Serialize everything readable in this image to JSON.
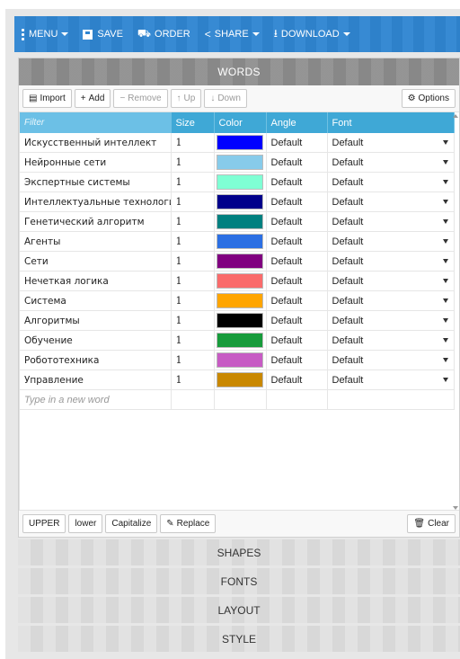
{
  "topbar": {
    "menu_label": "MENU",
    "save_label": "SAVE",
    "order_label": "ORDER",
    "share_label": "SHARE",
    "download_label": "DOWNLOAD"
  },
  "words_section": {
    "title": "WORDS",
    "toolbar": {
      "import": "Import",
      "add": "Add",
      "remove": "Remove",
      "up": "Up",
      "down": "Down",
      "options": "Options"
    },
    "columns": {
      "filter_placeholder": "Filter",
      "size": "Size",
      "color": "Color",
      "angle": "Angle",
      "font": "Font"
    },
    "rows": [
      {
        "word": "Искусственный интеллект",
        "size": "1",
        "color": "#0000ff",
        "angle": "Default",
        "font": "Default"
      },
      {
        "word": "Нейронные сети",
        "size": "1",
        "color": "#87cbea",
        "angle": "Default",
        "font": "Default"
      },
      {
        "word": "Экспертные системы",
        "size": "1",
        "color": "#7fffd4",
        "angle": "Default",
        "font": "Default"
      },
      {
        "word": "Интеллектуальные технологии",
        "size": "1",
        "color": "#00008b",
        "angle": "Default",
        "font": "Default"
      },
      {
        "word": "Генетический алгоритм",
        "size": "1",
        "color": "#008080",
        "angle": "Default",
        "font": "Default"
      },
      {
        "word": "Агенты",
        "size": "1",
        "color": "#2b6fe3",
        "angle": "Default",
        "font": "Default"
      },
      {
        "word": "Сети",
        "size": "1",
        "color": "#800080",
        "angle": "Default",
        "font": "Default"
      },
      {
        "word": "Нечеткая логика",
        "size": "1",
        "color": "#fa6b6b",
        "angle": "Default",
        "font": "Default"
      },
      {
        "word": "Система",
        "size": "1",
        "color": "#ffa500",
        "angle": "Default",
        "font": "Default"
      },
      {
        "word": "Алгоритмы",
        "size": "1",
        "color": "#000000",
        "angle": "Default",
        "font": "Default"
      },
      {
        "word": "Обучение",
        "size": "1",
        "color": "#179b3b",
        "angle": "Default",
        "font": "Default"
      },
      {
        "word": "Робототехника",
        "size": "1",
        "color": "#c75bc4",
        "angle": "Default",
        "font": "Default"
      },
      {
        "word": "Управление",
        "size": "1",
        "color": "#c98800",
        "angle": "Default",
        "font": "Default"
      }
    ],
    "new_word_placeholder": "Type in a new word",
    "bottom_toolbar": {
      "upper": "UPPER",
      "lower": "lower",
      "capitalize": "Capitalize",
      "replace": "Replace",
      "clear": "Clear"
    }
  },
  "collapsed_sections": [
    "SHAPES",
    "FONTS",
    "LAYOUT",
    "STYLE"
  ],
  "icons": {
    "menu": "vertical-dots-icon",
    "save": "floppy-icon",
    "order": "cart-icon",
    "share": "share-icon",
    "download": "download-icon"
  },
  "colors": {
    "topbar": "#2f85d1",
    "table_header": "#3fa8d6",
    "section_header": "#8e8e8e"
  }
}
